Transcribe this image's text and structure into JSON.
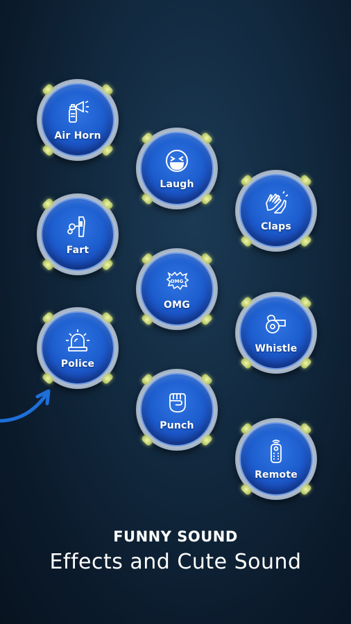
{
  "buttons": {
    "air_horn": {
      "label": "Air Horn",
      "icon": "air-horn-icon"
    },
    "laugh": {
      "label": "Laugh",
      "icon": "laugh-emoji-icon"
    },
    "claps": {
      "label": "Claps",
      "icon": "clapping-hands-icon"
    },
    "fart": {
      "label": "Fart",
      "icon": "fart-icon"
    },
    "omg": {
      "label": "OMG",
      "icon": "omg-bubble-icon",
      "icon_text": "OMG"
    },
    "whistle": {
      "label": "Whistle",
      "icon": "whistle-icon"
    },
    "police": {
      "label": "Police",
      "icon": "police-siren-icon"
    },
    "punch": {
      "label": "Punch",
      "icon": "punch-fist-icon"
    },
    "remote": {
      "label": "Remote",
      "icon": "remote-control-icon"
    }
  },
  "caption": {
    "headline": "FUNNY SOUND",
    "subline": "Effects and Cute Sound"
  },
  "colors": {
    "background": "#0b1a2b",
    "button_blue": "#1e5fd0",
    "ring_silver": "#b5c3d4",
    "tab_glow": "#e6f58c",
    "arrow": "#1e6fd8"
  }
}
